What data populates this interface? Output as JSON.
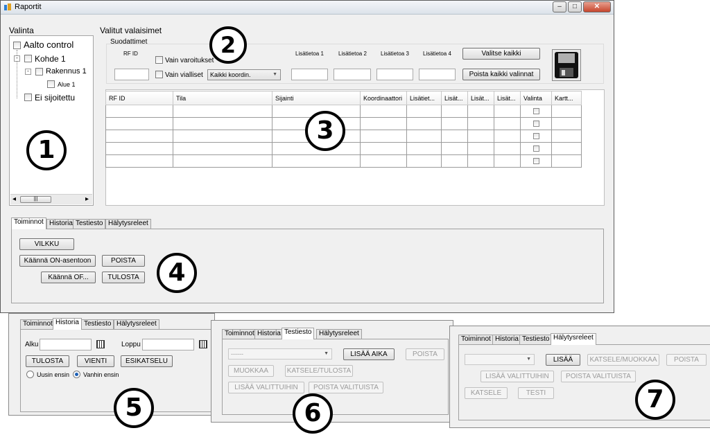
{
  "window": {
    "title": "Raportit",
    "minimize": "–",
    "maximize": "□",
    "close": "✕"
  },
  "left_panel": {
    "title": "Valinta",
    "tree": [
      {
        "label": "Aalto control"
      },
      {
        "label": "Kohde 1"
      },
      {
        "label": "Rakennus 1"
      },
      {
        "label": "Alue 1"
      },
      {
        "label": "Ei sijoitettu"
      }
    ],
    "scroll_left": "◂",
    "scroll_right": "▸",
    "scroll_thumb": "|||"
  },
  "top": {
    "title": "Valitut valaisimet",
    "filters_title": "Suodattimet",
    "rf_id_label": "RF ID",
    "only_warnings": "Vain varoitukset",
    "only_faulty": "Vain vialliset",
    "coord_select": "Kaikki koordin.",
    "extra_labels": [
      "Lisätietoa 1",
      "Lisätietoa 2",
      "Lisätietoa 3",
      "Lisätietoa 4"
    ],
    "select_all": "Valitse kaikki",
    "clear_all": "Poista kaikki valinnat",
    "save_icon": "floppy-disk-icon"
  },
  "table": {
    "columns": [
      "RF ID",
      "Tila",
      "Sijainti",
      "Koordinaattori",
      "Lisätiet...",
      "Lisät...",
      "Lisät...",
      "Lisät...",
      "Valinta",
      "Kartt..."
    ],
    "rows": 5
  },
  "tabs": [
    "Toiminnot",
    "Historia",
    "Testiesto",
    "Hälytysreleet"
  ],
  "toiminnot": {
    "vilkku": "VILKKU",
    "turn_on": "Käännä ON-asentoon",
    "delete": "POISTA",
    "turn_off": "Käännä OF...",
    "print": "TULOSTA"
  },
  "historia": {
    "start_label": "Alku",
    "end_label": "Loppu",
    "print": "TULOSTA",
    "export": "VIENTI",
    "preview": "ESIKATSELU",
    "newest_first": "Uusin ensin",
    "oldest_first": "Vanhin ensin"
  },
  "testiesto": {
    "select": "------",
    "add_time": "LISÄÄ AIKA",
    "delete": "POISTA",
    "edit": "MUOKKAA",
    "view_print": "KATSELE/TULOSTA",
    "add_selected": "LISÄÄ VALITTUIHIN",
    "remove_selected": "POISTA VALITUISTA"
  },
  "halytysreleet": {
    "add": "LISÄÄ",
    "view_edit": "KATSELE/MUOKKAA",
    "delete": "POISTA",
    "add_selected": "LISÄÄ VALITTUIHIN",
    "remove_selected": "POISTA VALITUISTA",
    "view": "KATSELE",
    "test": "TESTI"
  },
  "callouts": [
    "1",
    "2",
    "3",
    "4",
    "5",
    "6",
    "7"
  ],
  "colors": {
    "window_bg": "#f0f0f0",
    "border": "#5b5b5b",
    "close_button": "#c6452c"
  }
}
